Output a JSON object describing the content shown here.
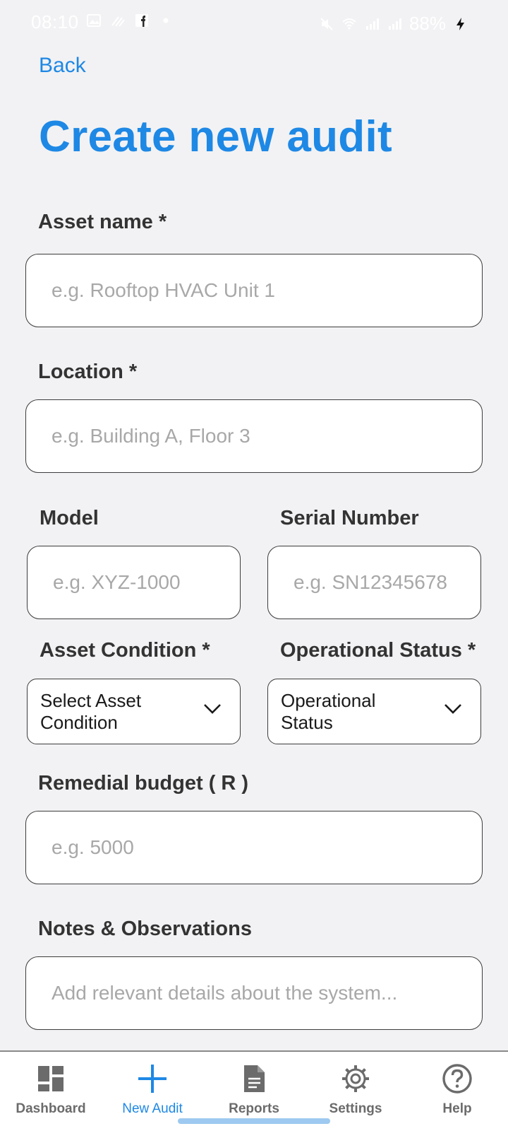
{
  "status_bar": {
    "time": "08:10",
    "battery": "88%"
  },
  "header": {
    "back_label": "Back",
    "title": "Create new audit"
  },
  "form": {
    "asset_name": {
      "label": "Asset name *",
      "placeholder": "e.g. Rooftop HVAC Unit 1"
    },
    "location": {
      "label": "Location *",
      "placeholder": "e.g. Building A, Floor 3"
    },
    "model": {
      "label": "Model",
      "placeholder": "e.g. XYZ-1000"
    },
    "serial_number": {
      "label": "Serial Number",
      "placeholder": "e.g. SN12345678"
    },
    "asset_condition": {
      "label": "Asset Condition *",
      "value_line1": "Select Asset",
      "value_line2": "Condition"
    },
    "operational_status": {
      "label": "Operational Status *",
      "value_line1": "Operational",
      "value_line2": "Status"
    },
    "remedial_budget": {
      "label": "Remedial budget ( R )",
      "placeholder": "e.g. 5000"
    },
    "notes": {
      "label": "Notes & Observations",
      "placeholder": "Add relevant details about the system..."
    }
  },
  "bottom_nav": {
    "items": [
      {
        "label": "Dashboard",
        "icon": "dashboard-icon",
        "active": false
      },
      {
        "label": "New Audit",
        "icon": "plus-icon",
        "active": true
      },
      {
        "label": "Reports",
        "icon": "document-icon",
        "active": false
      },
      {
        "label": "Settings",
        "icon": "gear-icon",
        "active": false
      },
      {
        "label": "Help",
        "icon": "help-icon",
        "active": false
      }
    ]
  },
  "colors": {
    "accent": "#1e88e5",
    "background": "#f2f2f4",
    "nav_inactive": "#6b6b6b"
  }
}
